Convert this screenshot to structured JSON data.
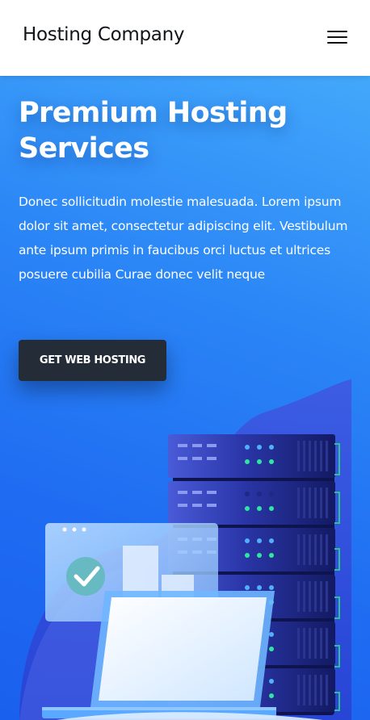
{
  "navbar": {
    "brand": "Hosting Company",
    "menu_icon": "hamburger-menu-icon"
  },
  "hero": {
    "title": "Premium Hosting Services",
    "description": "Donec sollicitudin molestie malesuada. Lorem ipsum dolor sit amet, consectetur adipiscing elit. Vestibulum ante ipsum primis in faucibus orci luctus et ultrices posuere cubilia Curae donec velit neque",
    "cta_label": "GET WEB HOSTING",
    "illustration": "server-rack-laptop-illustration"
  },
  "colors": {
    "hero_gradient_start": "#43a8fb",
    "hero_gradient_end": "#1a60ee",
    "cta_background": "#242c38",
    "text_light": "#ffffff",
    "text_dark": "#111418"
  }
}
